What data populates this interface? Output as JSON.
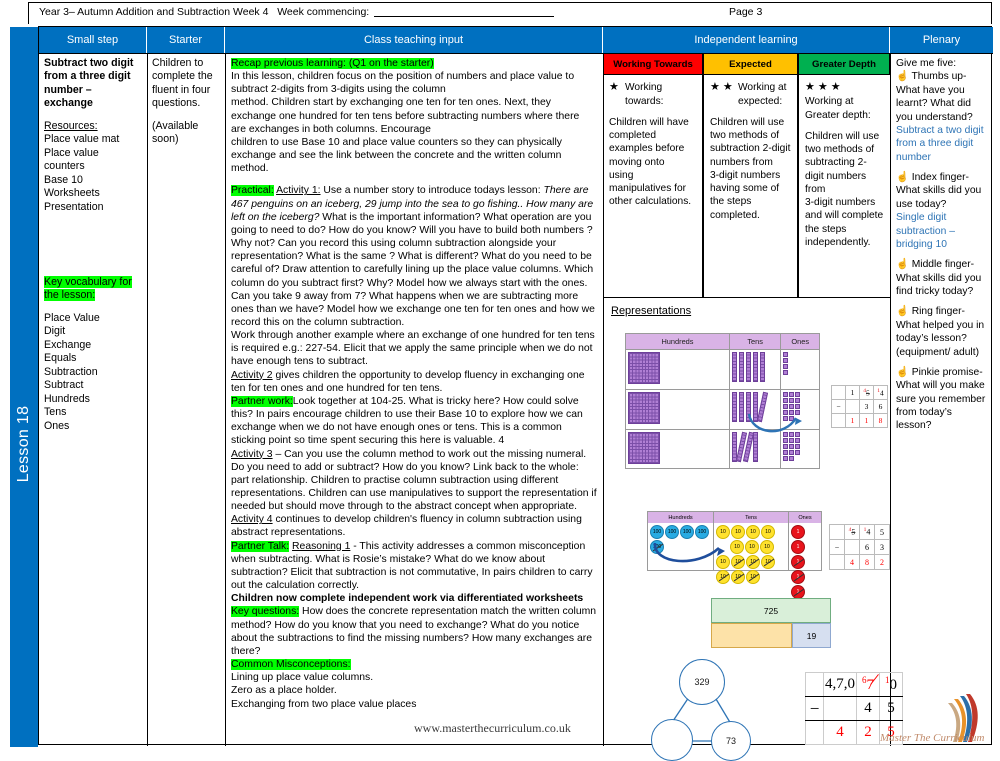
{
  "header": {
    "title": "Year 3– Autumn Addition and Subtraction Week 4",
    "week_commencing_label": "Week commencing:",
    "page_label": "Page 3"
  },
  "lesson_tab": {
    "label": "Lesson 18"
  },
  "columns": [
    {
      "id": "small-step",
      "label": "Small step"
    },
    {
      "id": "starter",
      "label": "Starter"
    },
    {
      "id": "class-teaching-input",
      "label": "Class teaching input"
    },
    {
      "id": "independent-learning",
      "label": "Independent learning"
    },
    {
      "id": "plenary",
      "label": "Plenary"
    }
  ],
  "small_step": {
    "title": "Subtract two digit from a three digit number – exchange",
    "resources_heading": "Resources:",
    "resources": [
      "Place value mat",
      "Place value",
      "counters",
      "Base 10",
      "Worksheets",
      "Presentation"
    ],
    "vocab_heading": "Key vocabulary for the lesson:",
    "vocab": [
      "Place Value",
      "Digit",
      "Exchange",
      "Equals",
      "Subtraction",
      "Subtract",
      "Hundreds",
      "Tens",
      "Ones"
    ]
  },
  "starter": {
    "line1": "Children to complete the fluent in four questions.",
    "line2": "(Available soon)"
  },
  "teaching": {
    "recap_label": "Recap previous learning: (Q1 on the starter)",
    "recap_body": "In this lesson, children focus on the position of numbers and place value to subtract 2-digits from 3-digits using the column",
    "recap_body2": "method. Children start by exchanging one ten for ten ones. Next, they exchange one hundred for ten tens before subtracting numbers where there are exchanges in both columns. Encourage",
    "recap_body3": "children to use Base 10 and place value counters so they can physically exchange and see the link between the concrete and the written column method.",
    "practical_label": "Practical:",
    "activity1_label": "Activity 1:",
    "activity1_lead": "Use a number story to introduce todays lesson:",
    "activity1_story": "There are 467 penguins on an iceberg,  29 jump into the sea to go fishing.. How many are left on the iceberg?",
    "activity1_body": "What is the important information?  What operation are you going to need to do?  How do you know?  Will you have to build both numbers ?  Why not?  Can you record this using column subtraction alongside your  representation?  What is the same ? What is different?  What do you need to be careful of?  Draw attention to carefully lining up the place value columns.  Which column do you subtract first? Why? Model how we always start with the ones.  Can you take 9 away from 7?  What happens when we are subtracting more ones than we have? Model how we exchange one ten for ten ones and how we record this on the column subtraction.",
    "worked_example": "Work through another example where an exchange  of one hundred for ten tens is required e.g.: 227-54. Elicit that we  apply the same principle when we do not have enough tens to subtract.",
    "activity2_label": "Activity 2",
    "activity2_body": " gives children the opportunity to develop fluency in exchanging one ten for ten ones and one hundred for ten tens.",
    "partner_work_label": "Partner work:",
    "partner_work_body": "Look together at 104-25.  What is tricky here?  How could solve this?   In pairs encourage children to use their Base 10 to explore how we can exchange when we do not have enough ones or tens.  This is a common sticking point so time spent  securing this here is valuable. 4",
    "activity3_label": "Activity 3",
    "activity3_body": " – Can you use the column method to work out the missing numeral.  Do you need to add or subtract?  How do you know?  Link back to the whole: part relationship.  Children to practise column subtraction using different representations.  Children can use  manipulatives to support the representation  if needed but should move through to the abstract concept when appropriate.",
    "activity4_label": "Activity 4",
    "activity4_body": " continues to develop children's fluency in column subtraction using abstract representations.",
    "partner_talk_label": "Partner Talk:",
    "reasoning_label": "Reasoning 1",
    "partner_talk_body": " -  This activity addresses a common misconception when subtracting.  What is Rosie’s mistake?  What do we know about subtraction?  Elicit that subtraction is not commutative, In pairs children to carry out the calculation correctly.",
    "independent_bold": "Children now complete independent work via differentiated  worksheets",
    "key_questions_label": "Key questions:",
    "key_questions_body": " How does the concrete representation match the written column method? How do you know that you need to exchange? What do you notice about the subtractions to find the missing numbers? How many exchanges are there?",
    "misconceptions_label": "Common Misconceptions:",
    "misconceptions": [
      "Lining up place value columns.",
      "Zero as a place holder.",
      "Exchanging from two place value places"
    ],
    "watermark": "www.masterthecurriculum.co.uk"
  },
  "independent": {
    "bands": [
      {
        "label": "Working Towards",
        "color": "#FF0000",
        "stars": 1,
        "heading": "Working towards:",
        "body": "Children will have completed examples before moving onto\nusing manipulatives for other calculations."
      },
      {
        "label": "Expected",
        "color": "#FFC000",
        "stars": 2,
        "heading": "Working at expected:",
        "body": "Children will use two methods of subtraction 2-digit numbers from\n3-digit numbers having some of the steps completed."
      },
      {
        "label": "Greater Depth",
        "color": "#00B050",
        "stars": 3,
        "heading": "Working at Greater depth:",
        "body": "Children will use two methods of subtracting 2-digit numbers from\n3-digit numbers and will complete\nthe steps independently."
      }
    ],
    "representations_title": "Representations",
    "base_ten_table": {
      "headers": [
        "Hundreds",
        "Tens",
        "Ones"
      ],
      "rows": [
        {
          "hundreds": 1,
          "tens": 5,
          "ones": 4
        },
        {
          "hundreds": 1,
          "tens": 5,
          "ones": 14
        },
        {
          "hundreds": 1,
          "tens": 4,
          "ones": 14
        }
      ]
    },
    "sum_a": {
      "minuend_digits": [
        "1",
        "5",
        "4"
      ],
      "exchange_marks": [
        "",
        "4",
        "1"
      ],
      "subtrahend": [
        "",
        "3",
        "6"
      ],
      "answer": [
        "1",
        "1",
        "8"
      ]
    },
    "counters_table": {
      "headers": [
        "Hundreds",
        "Tens",
        "Ones"
      ],
      "hundreds_label": "100",
      "tens_label": "10",
      "ones_label": "1"
    },
    "sum_b": {
      "minuend_digits": [
        "5",
        "4",
        "5"
      ],
      "exchange_marks": [
        "4",
        "1",
        ""
      ],
      "subtrahend": [
        "",
        "6",
        "3"
      ],
      "answer": [
        "4",
        "8",
        "2"
      ]
    },
    "bar_model": {
      "whole": "725",
      "part": "19"
    },
    "part_whole": {
      "whole": "329",
      "part_known": "73",
      "part_unknown": ""
    },
    "big_sum": {
      "minuend": [
        "4",
        "7",
        "0"
      ],
      "exchange_tens": "6",
      "exchange_ones": "1",
      "subtrahend": [
        "",
        "4",
        "5"
      ],
      "answer": [
        "4",
        "2",
        "5"
      ]
    }
  },
  "plenary": {
    "intro": "Give me five:",
    "items": [
      {
        "icon": "hand-icon",
        "question": "Thumbs up- What have you learnt? What did you understand?",
        "answer": "Subtract a two digit from a three digit number"
      },
      {
        "icon": "hand-icon",
        "question": "Index finger- What skills did you use today?",
        "answer": "Single digit subtraction – bridging 10"
      },
      {
        "icon": "hand-icon",
        "question": "Middle finger- What skills did you find tricky today?",
        "answer": ""
      },
      {
        "icon": "hand-icon",
        "question": "Ring finger- What helped you in today’s lesson? (equipment/ adult)",
        "answer": ""
      },
      {
        "icon": "hand-icon",
        "question": "Pinkie promise- What will you make sure you remember from today’s lesson?",
        "answer": ""
      }
    ]
  },
  "brand": {
    "footer_mark": "Master The Curriculum"
  }
}
